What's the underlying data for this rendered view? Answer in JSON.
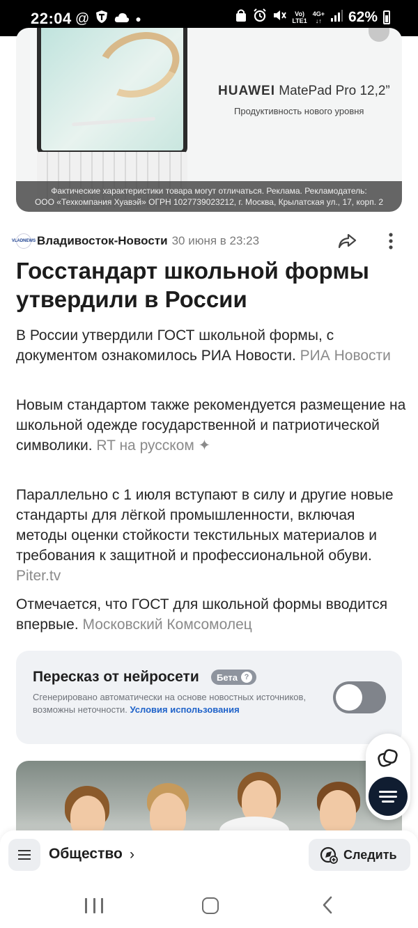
{
  "status_bar": {
    "time": "22:04",
    "net_top": "Vo)",
    "net_bottom": "LTE1",
    "gen_top": "4G+",
    "gen_bottom": "↓↑",
    "battery": "62%"
  },
  "ad": {
    "brand": "HUAWEI",
    "product": "MatePad Pro 12,2”",
    "tagline": "Продуктивность нового уровня",
    "disclaimer_line1": "Фактические характеристики товара могут отличаться. Реклама. Рекламодатель:",
    "disclaimer_line2": "ООО «Техкомпания Хуавэй» ОГРН 1027739023212, г. Москва, Крылатская ул., 17, корп. 2"
  },
  "article": {
    "source_name": "Владивосток-Новости",
    "date": "30 июня в 23:23",
    "headline": "Госстандарт школьной формы утвердили в России",
    "paragraphs": [
      {
        "text": "В России утвердили ГОСТ школьной формы, с документом ознакомилось РИА Новости.",
        "source": "РИА Новости"
      },
      {
        "text": "Новым стандартом также рекомендуется размещение на школьной одежде государственной и патриотической символики.",
        "source": "RT на русском ✦"
      },
      {
        "text": "Параллельно с 1 июля вступают в силу и другие новые стандарты для лёгкой промышленности, включая методы оценки стойкости текстильных материалов и требования к защитной и профессиональной обуви.",
        "source": "Piter.tv"
      },
      {
        "text": "Отмечается, что ГОСТ для школьной формы вводится впервые.",
        "source": "Московский Комсомолец"
      }
    ]
  },
  "ai_summary": {
    "title": "Пересказ от нейросети",
    "badge": "Бета",
    "badge_icon": "?",
    "description": "Сгенерировано автоматически на основе новостных источников, возможны неточности.",
    "link": "Условия использования",
    "toggle_on": false
  },
  "bottom_bar": {
    "rubric": "Общество",
    "rubric_chevron": "›",
    "follow": "Следить"
  },
  "colors": {
    "accent_link": "#1e62c9",
    "fab_dark": "#101d31",
    "toggle_off": "#80848b"
  }
}
